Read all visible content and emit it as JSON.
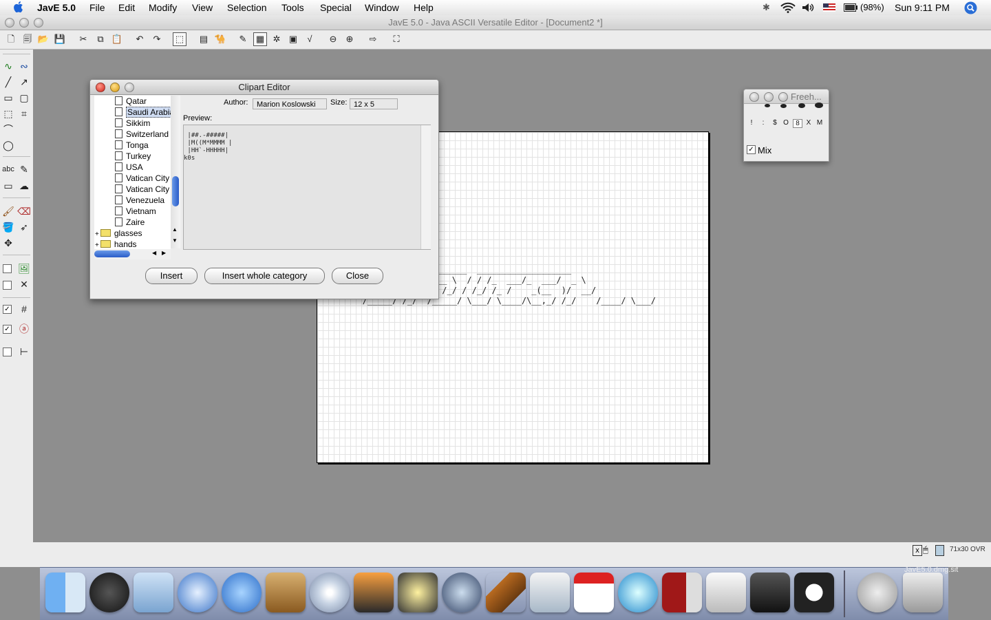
{
  "menubar": {
    "app_name": "JavE 5.0",
    "items": [
      "File",
      "Edit",
      "Modify",
      "View",
      "Selection",
      "Tools",
      "Special",
      "Window",
      "Help"
    ],
    "battery": "(98%)",
    "clock": "Sun 9:11 PM"
  },
  "window": {
    "title": "JavE 5.0 - Java ASCII Versatile Editor - [Document2 *]"
  },
  "canvas": {
    "ascii_lines": [
      "   ________ ____________  ___________________",
      "   ______/  ___/  __ \\  / / /_  ___/_  ___/  _ \\",
      "   ______ )/ /__ / /_/ / /_/ /_ /    _(__  )/  __/",
      "   /_____/ /_/  /_____/ \\___/ \\____/\\__,_/ /_/    /____/ \\___/"
    ]
  },
  "clipart": {
    "title": "Clipart Editor",
    "author_label": "Author:",
    "author_value": "Marion Koslowski",
    "size_label": "Size:",
    "size_value": "12 x 5",
    "preview_label": "Preview:",
    "preview_text": " |##.-#####|\n |M((M*MMMM |\n |HH`-HHHHH|\nk0s",
    "tree_items": [
      "Qatar",
      "Saudi Arabia",
      "Sikkim",
      "Switzerland",
      "Tonga",
      "Turkey",
      "USA",
      "Vatican City",
      "Vatican City",
      "Venezuela",
      "Vietnam",
      "Zaire"
    ],
    "tree_folders": [
      "glasses",
      "hands"
    ],
    "selected_item": "Saudi Arabia",
    "buttons": {
      "insert": "Insert",
      "insert_whole_category": "Insert whole category",
      "close": "Close"
    }
  },
  "freehand": {
    "title": "Freeh...",
    "chars": [
      "!",
      ":",
      "$",
      "O",
      "8",
      "X",
      "M"
    ],
    "mix_label": "Mix",
    "mix_checked": true
  },
  "status": {
    "size_mode": "71x30 OVR"
  },
  "dock": {
    "items": [
      "finder-icon",
      "dashboard-icon",
      "mail-icon",
      "safari-icon",
      "ichat-icon",
      "address-book-icon",
      "itunes-icon",
      "iphoto-icon",
      "imovie-icon",
      "idvd-icon",
      "garageband-icon",
      "preview-icon",
      "ical-icon",
      "quicktime-icon",
      "photo-booth-icon",
      "system-preferences-icon",
      "terminal-icon",
      "jave-icon",
      "mail-sender-icon",
      "trash-icon"
    ],
    "download_label": "JavE5.0.dmg.sit"
  }
}
